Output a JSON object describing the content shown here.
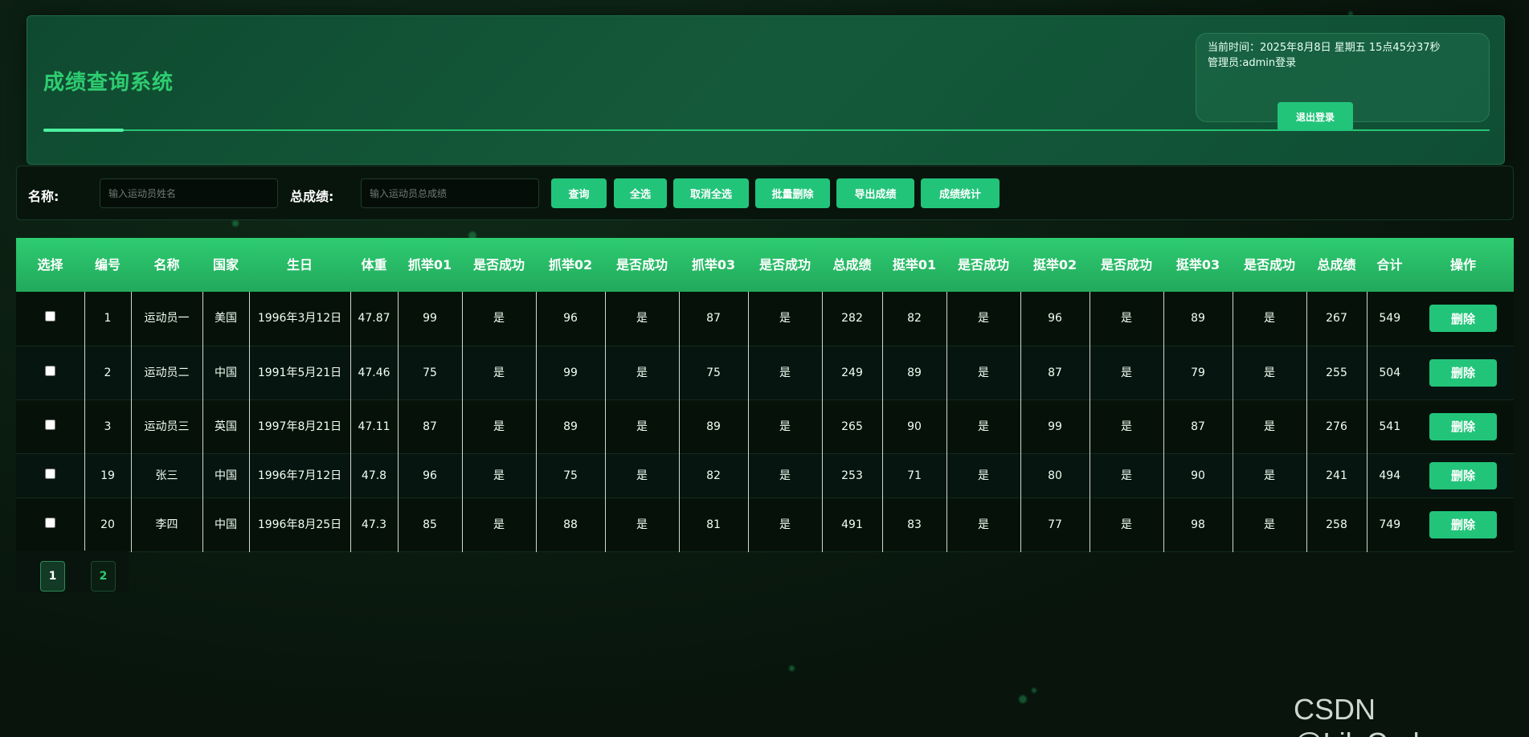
{
  "header": {
    "title": "成绩查询系统",
    "time_text": "当前时间：2025年8月8日 星期五 15点45分37秒",
    "admin_text": "管理员:admin登录",
    "logout_label": "退出登录"
  },
  "search": {
    "name_label": "名称:",
    "name_placeholder": "输入运动员姓名",
    "total_label": "总成绩:",
    "total_placeholder": "输入运动员总成绩",
    "buttons": [
      "查询",
      "全选",
      "取消全选",
      "批量删除",
      "导出成绩",
      "成绩统计"
    ]
  },
  "table": {
    "headers": [
      "选择",
      "编号",
      "名称",
      "国家",
      "生日",
      "体重",
      "抓举01",
      "是否成功",
      "抓举02",
      "是否成功",
      "抓举03",
      "是否成功",
      "总成绩",
      "挺举01",
      "是否成功",
      "挺举02",
      "是否成功",
      "挺举03",
      "是否成功",
      "总成绩",
      "合计",
      "操作"
    ],
    "rows": [
      [
        "1",
        "运动员一",
        "美国",
        "1996年3月12日",
        "47.87",
        "99",
        "是",
        "96",
        "是",
        "87",
        "是",
        "282",
        "82",
        "是",
        "96",
        "是",
        "89",
        "是",
        "267",
        "549"
      ],
      [
        "2",
        "运动员二",
        "中国",
        "1991年5月21日",
        "47.46",
        "75",
        "是",
        "99",
        "是",
        "75",
        "是",
        "249",
        "89",
        "是",
        "87",
        "是",
        "79",
        "是",
        "255",
        "504"
      ],
      [
        "3",
        "运动员三",
        "英国",
        "1997年8月21日",
        "47.11",
        "87",
        "是",
        "89",
        "是",
        "89",
        "是",
        "265",
        "90",
        "是",
        "99",
        "是",
        "87",
        "是",
        "276",
        "541"
      ],
      [
        "19",
        "张三",
        "中国",
        "1996年7月12日",
        "47.8",
        "96",
        "是",
        "75",
        "是",
        "82",
        "是",
        "253",
        "71",
        "是",
        "80",
        "是",
        "90",
        "是",
        "241",
        "494"
      ],
      [
        "20",
        "李四",
        "中国",
        "1996年8月25日",
        "47.3",
        "85",
        "是",
        "88",
        "是",
        "81",
        "是",
        "491",
        "83",
        "是",
        "77",
        "是",
        "98",
        "是",
        "258",
        "749"
      ]
    ],
    "delete_label": "删除"
  },
  "pagination": {
    "pages": [
      "1",
      "2"
    ],
    "current": "1"
  },
  "watermark": "CSDN @LilyCoder",
  "colors": {
    "accent": "#22c47a",
    "title": "#2ecc71",
    "bg": "#0b1a10"
  }
}
